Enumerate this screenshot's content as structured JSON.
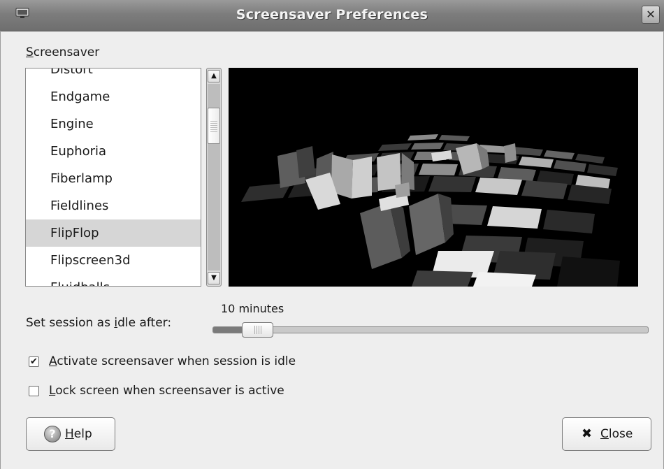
{
  "window": {
    "title": "Screensaver Preferences",
    "close_glyph": "✕",
    "app_icon": "monitor-icon"
  },
  "screensaver": {
    "section_label": "Screensaver",
    "items": [
      {
        "label": "Distort",
        "selected": false
      },
      {
        "label": "Endgame",
        "selected": false
      },
      {
        "label": "Engine",
        "selected": false
      },
      {
        "label": "Euphoria",
        "selected": false
      },
      {
        "label": "Fiberlamp",
        "selected": false
      },
      {
        "label": "Fieldlines",
        "selected": false
      },
      {
        "label": "FlipFlop",
        "selected": true
      },
      {
        "label": "Flipscreen3d",
        "selected": false
      },
      {
        "label": "Fluidballs",
        "selected": false
      }
    ],
    "preview_name": "FlipFlop"
  },
  "idle": {
    "label": "Set session as idle after:",
    "value_text": "10 minutes",
    "level": 0.085
  },
  "options": {
    "activate": {
      "label": "Activate screensaver when session is idle",
      "checked": true
    },
    "lock": {
      "label": "Lock screen when screensaver is active",
      "checked": false
    }
  },
  "buttons": {
    "help_label": "Help",
    "close_label": "Close"
  },
  "colors": {
    "titlebar": "#7d7d7d",
    "selection": "#d6d6d6"
  }
}
